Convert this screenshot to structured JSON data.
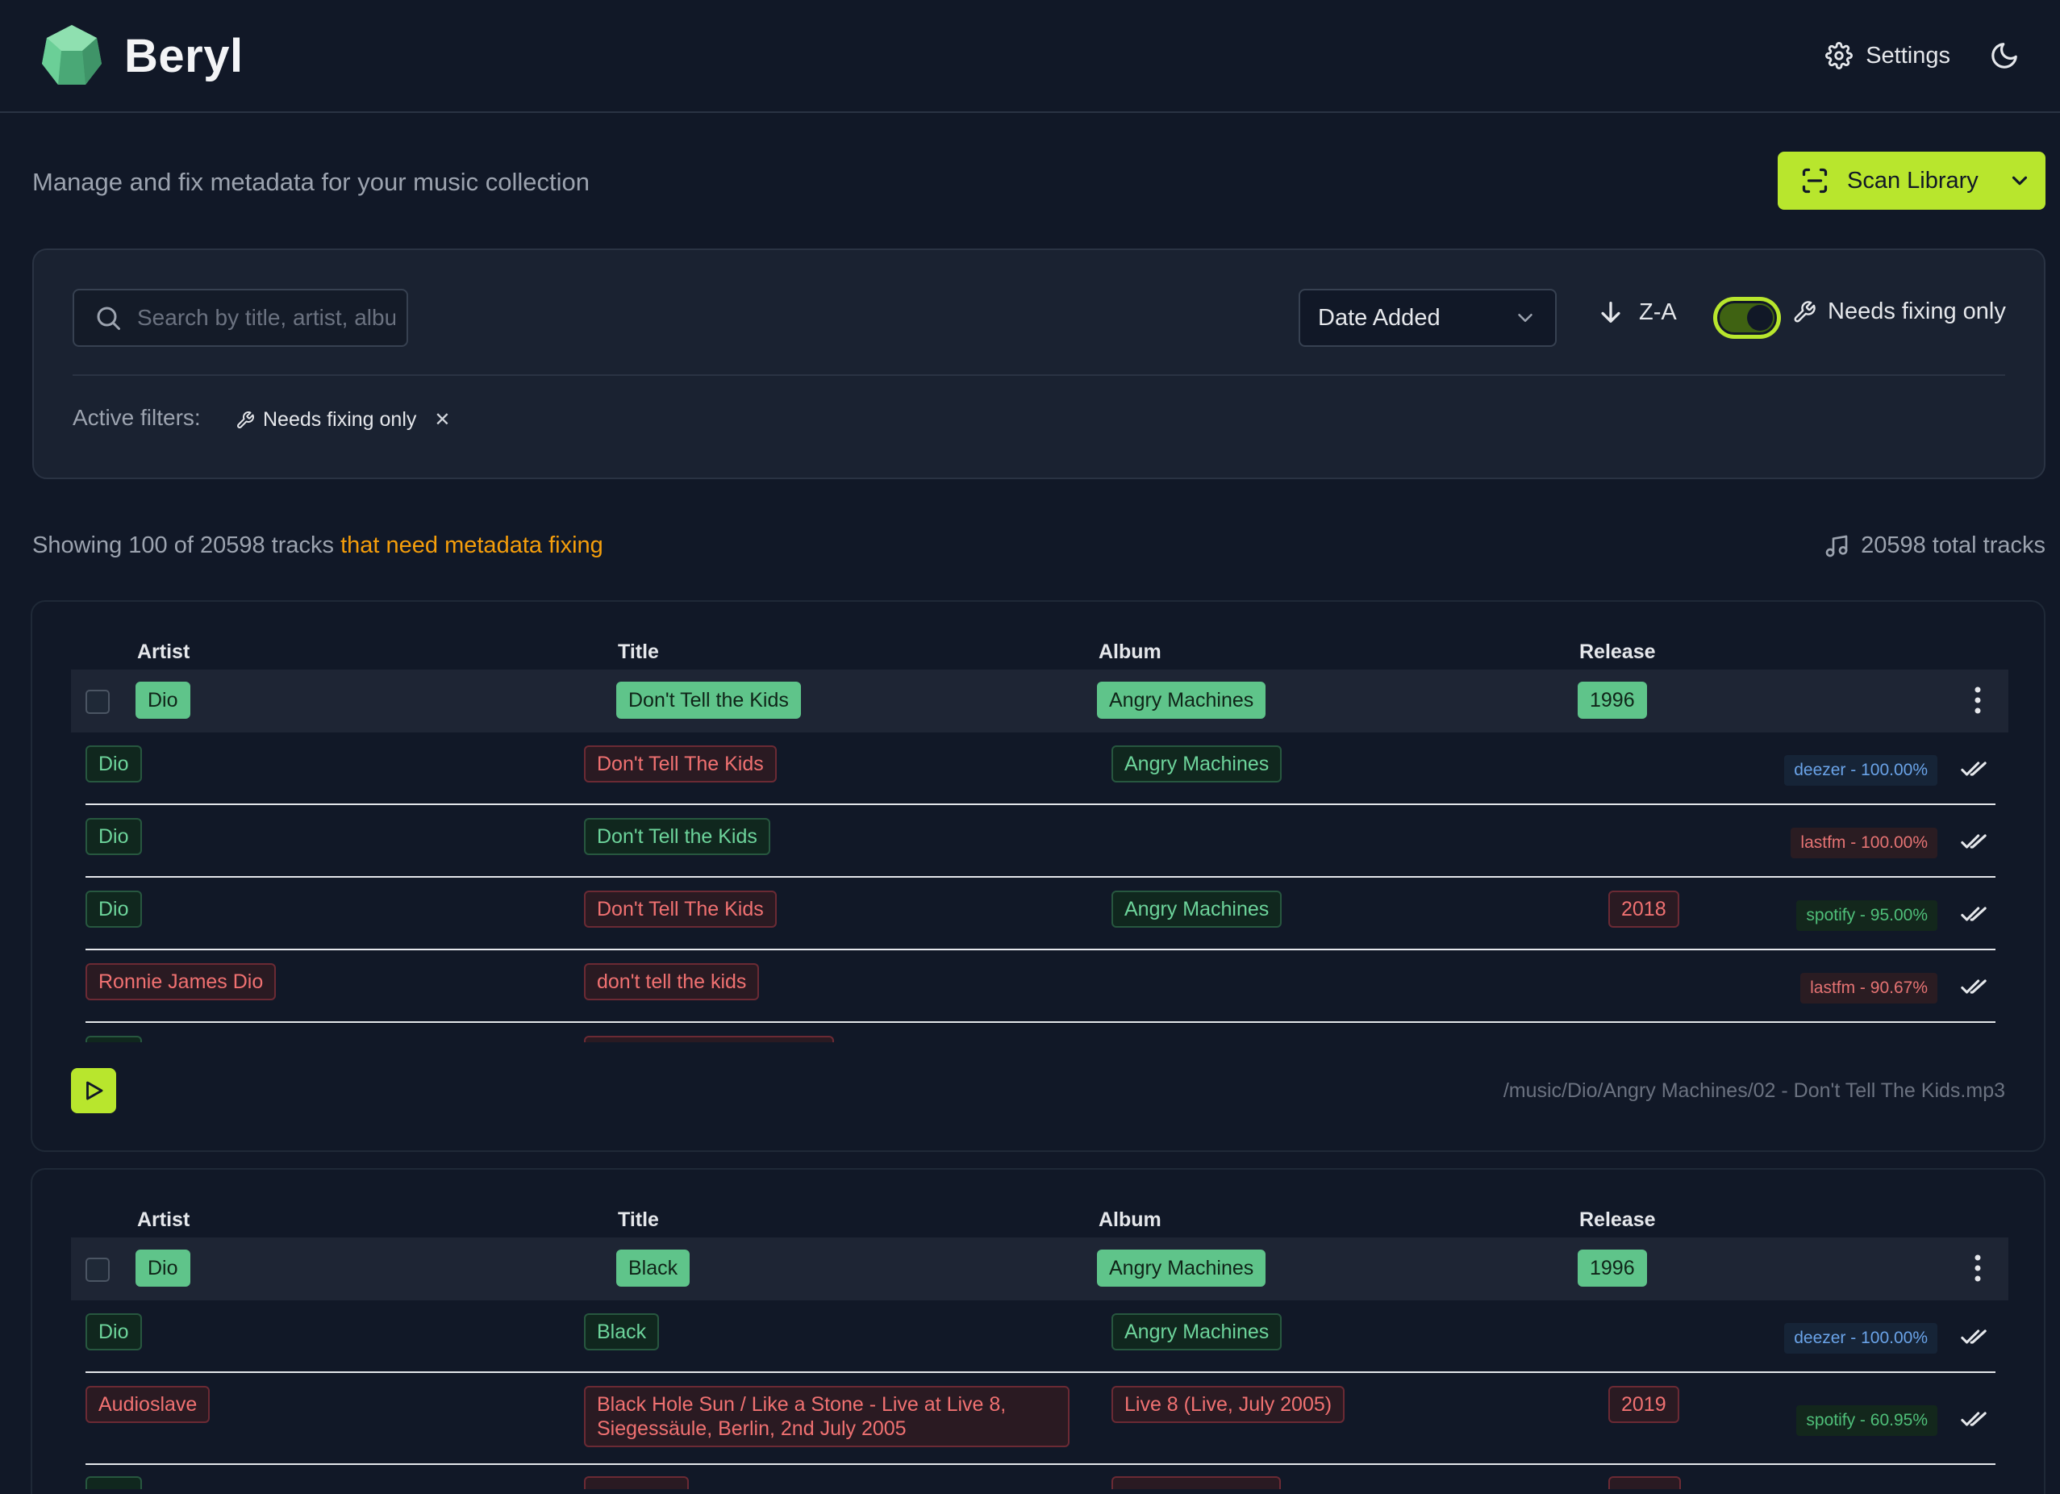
{
  "app": {
    "brand": "Beryl",
    "settings_label": "Settings",
    "subtitle": "Manage and fix metadata for your music collection",
    "scan_label": "Scan Library"
  },
  "filters": {
    "search_placeholder": "Search by title, artist, album...",
    "sort_by": "Date Added",
    "sort_dir": "Z-A",
    "needs_fixing_label": "Needs fixing only",
    "needs_fixing_on": true,
    "active_label": "Active filters:",
    "active_chip": "Needs fixing only"
  },
  "summary": {
    "showing_prefix": "Showing 100 of 20598 tracks",
    "showing_highlight": "that need metadata fixing",
    "total": "20598 total tracks"
  },
  "columns": {
    "artist": "Artist",
    "title": "Title",
    "album": "Album",
    "release": "Release"
  },
  "tracks": [
    {
      "artist": "Dio",
      "title": "Don't Tell the Kids",
      "album": "Angry Machines",
      "release": "1996",
      "path": "/music/Dio/Angry Machines/02 - Don't Tell The Kids.mp3",
      "matches": [
        {
          "artist": "Dio",
          "title": "Don't Tell The Kids",
          "album": "Angry Machines",
          "release": "",
          "source": "deezer - 100.00%"
        },
        {
          "artist": "Dio",
          "title": "Don't Tell the Kids",
          "album": "",
          "release": "",
          "source": "lastfm - 100.00%"
        },
        {
          "artist": "Dio",
          "title": "Don't Tell The Kids",
          "album": "Angry Machines",
          "release": "2018",
          "source": "spotify - 95.00%"
        },
        {
          "artist": "Ronnie James Dio",
          "title": "don't tell the kids",
          "album": "",
          "release": "",
          "source": "lastfm - 90.67%"
        }
      ]
    },
    {
      "artist": "Dio",
      "title": "Black",
      "album": "Angry Machines",
      "release": "1996",
      "matches": [
        {
          "artist": "Dio",
          "title": "Black",
          "album": "Angry Machines",
          "release": "",
          "source": "deezer - 100.00%"
        },
        {
          "artist": "Audioslave",
          "title": "Black Hole Sun / Like a Stone - Live at Live 8, Siegessäule, Berlin, 2nd July 2005",
          "album": "Live 8 (Live, July 2005)",
          "release": "2019",
          "source": "spotify - 60.95%"
        }
      ]
    }
  ],
  "colors": {
    "accent": "#b8e62d",
    "match": "#6dd49b",
    "mismatch": "#f07171",
    "highlight": "#f59e0b"
  }
}
